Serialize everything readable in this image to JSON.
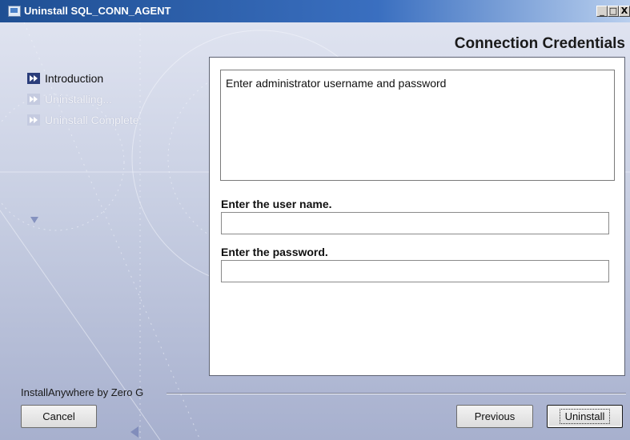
{
  "window": {
    "title": "Uninstall SQL_CONN_AGENT",
    "icon": "installer-icon",
    "controls": {
      "minimize": "_",
      "maximize": "□",
      "close": "X"
    }
  },
  "header": {
    "title": "Connection Credentials"
  },
  "steps": [
    {
      "label": "Introduction",
      "state": "active"
    },
    {
      "label": "Uninstalling...",
      "state": "inactive"
    },
    {
      "label": "Uninstall Complete",
      "state": "inactive"
    }
  ],
  "panel": {
    "description": "Enter administrator username and password",
    "username": {
      "label": "Enter the user name.",
      "value": ""
    },
    "password": {
      "label": "Enter the password.",
      "value": ""
    }
  },
  "footer": {
    "brand": "InstallAnywhere by Zero G",
    "cancel_label": "Cancel",
    "previous_label": "Previous",
    "uninstall_label": "Uninstall"
  },
  "colors": {
    "titlebar": "#2a5ca8",
    "background": "#c7cee2",
    "step_active": "#2a3d7a"
  }
}
